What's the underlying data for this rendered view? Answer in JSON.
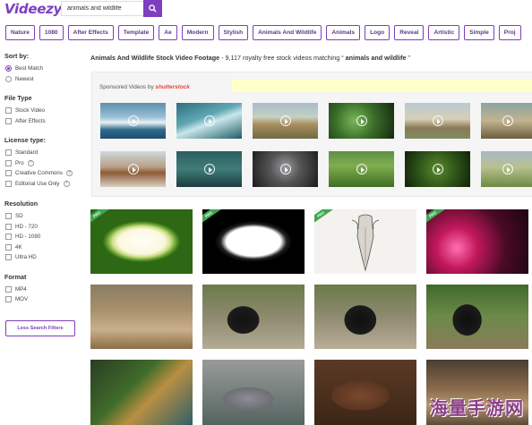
{
  "brand": {
    "logo": "Videezy",
    "accent": "#7d3fbe"
  },
  "search": {
    "value": "animals and wildlife",
    "icon": "search-icon"
  },
  "tags": [
    "Nature",
    "1080",
    "After Effects",
    "Template",
    "Ae",
    "Modern",
    "Stylish",
    "Animals And Wildlife",
    "Animals",
    "Logo",
    "Reveal",
    "Artistic",
    "Simple",
    "Proj"
  ],
  "sidebar": {
    "sort": {
      "heading": "Sort by:",
      "options": [
        "Best Match",
        "Newest"
      ],
      "selected": "Best Match"
    },
    "file_type": {
      "heading": "File Type",
      "options": [
        "Stock Video",
        "After Effects"
      ]
    },
    "license": {
      "heading": "License type:",
      "options": [
        "Standard",
        "Pro",
        "Creative Commons",
        "Editorial Use Only"
      ]
    },
    "resolution": {
      "heading": "Resolution",
      "options": [
        "SD",
        "HD - 720",
        "HD - 1080",
        "4K",
        "Ultra HD"
      ]
    },
    "format": {
      "heading": "Format",
      "options": [
        "MP4",
        "MOV"
      ]
    },
    "less_filters": "Less Search Filters"
  },
  "results": {
    "title": "Animals And Wildlife Stock Video Footage",
    "count_text": " - 9,117 royalty free stock videos matching “ ",
    "query": "animals and wildlife",
    "close_quote": " ”"
  },
  "sponsored": {
    "label": "Sponsored Videos by",
    "brand": "shutterstock"
  },
  "pro_badge": "PRO",
  "watermark": "海量手游网"
}
